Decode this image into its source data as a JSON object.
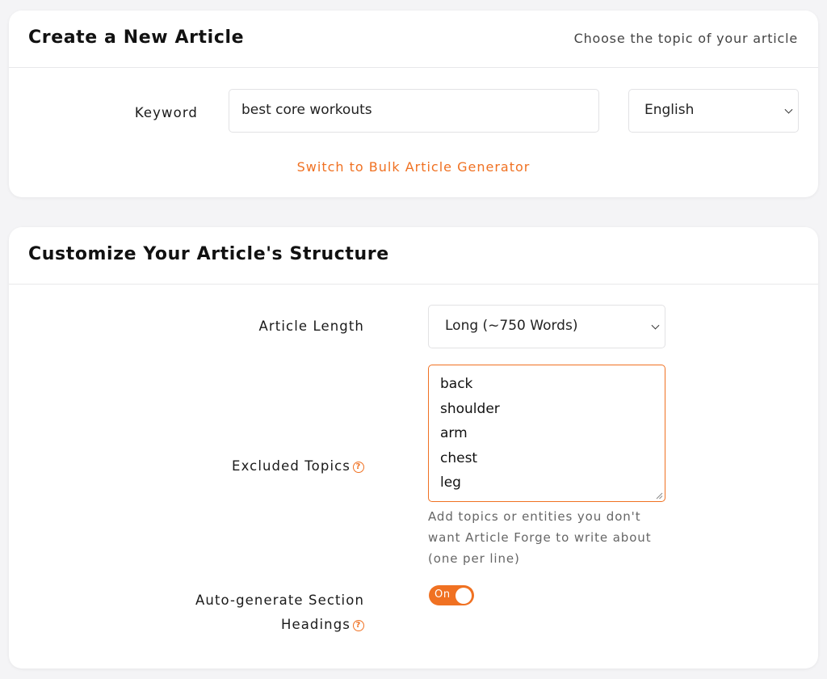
{
  "create_card": {
    "title": "Create a New Article",
    "subtitle": "Choose the topic of your article",
    "keyword_label": "Keyword",
    "keyword_value": "best core workouts",
    "language_value": "English",
    "bulk_link": "Switch to Bulk Article Generator"
  },
  "structure_card": {
    "title": "Customize Your Article's Structure",
    "length_label": "Article Length",
    "length_value": "Long (~750 Words)",
    "excluded_label": "Excluded Topics",
    "excluded_topics": [
      "back",
      "shoulder",
      "arm",
      "chest",
      "leg"
    ],
    "excluded_hint": "Add topics or entities you don't want Article Forge to write about (one per line)",
    "headings_label_line1": "Auto-generate Section",
    "headings_label_line2": "Headings",
    "headings_toggle": "On"
  },
  "icons": {
    "help": "help-circle-icon",
    "dropdown": "chevron-down-icon"
  },
  "colors": {
    "accent": "#f07122",
    "background": "#f4f4f6",
    "card": "#ffffff"
  }
}
